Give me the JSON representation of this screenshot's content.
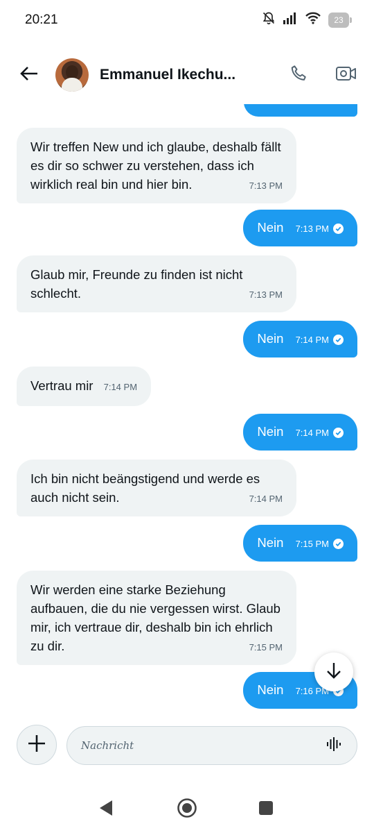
{
  "status_bar": {
    "time": "20:21",
    "battery": "23"
  },
  "header": {
    "contact_name": "Emmanuel Ikechu..."
  },
  "messages": [
    {
      "dir": "in",
      "text": "Wir treffen New und ich glaube, deshalb fällt es dir so schwer zu verstehen, dass ich wirklich real bin und hier bin.",
      "time": "7:13 PM"
    },
    {
      "dir": "out",
      "text": "Nein",
      "time": "7:13 PM"
    },
    {
      "dir": "in",
      "text": "Glaub mir, Freunde zu finden ist nicht schlecht.",
      "time": "7:13 PM"
    },
    {
      "dir": "out",
      "text": "Nein",
      "time": "7:14 PM"
    },
    {
      "dir": "in",
      "text": "Vertrau mir",
      "time": "7:14 PM"
    },
    {
      "dir": "out",
      "text": "Nein",
      "time": "7:14 PM"
    },
    {
      "dir": "in",
      "text": "Ich bin nicht beängstigend und werde es auch nicht sein.",
      "time": "7:14 PM"
    },
    {
      "dir": "out",
      "text": "Nein",
      "time": "7:15 PM"
    },
    {
      "dir": "in",
      "text": "Wir werden eine starke Beziehung aufbauen, die du nie vergessen wirst. Glaub mir, ich vertraue dir, deshalb bin ich ehrlich zu dir.",
      "time": "7:15 PM"
    },
    {
      "dir": "out",
      "text": "Nein",
      "time": "7:16 PM"
    }
  ],
  "composer": {
    "placeholder": "Nachricht"
  },
  "colors": {
    "outgoing_bubble": "#1d9bf0",
    "incoming_bubble": "#eff3f4"
  },
  "icons": {
    "back": "arrow-left-icon",
    "call": "phone-icon",
    "video": "video-camera-icon",
    "add": "plus-icon",
    "voice": "waveform-icon",
    "scroll": "arrow-down-icon",
    "read": "check-circle-icon"
  }
}
